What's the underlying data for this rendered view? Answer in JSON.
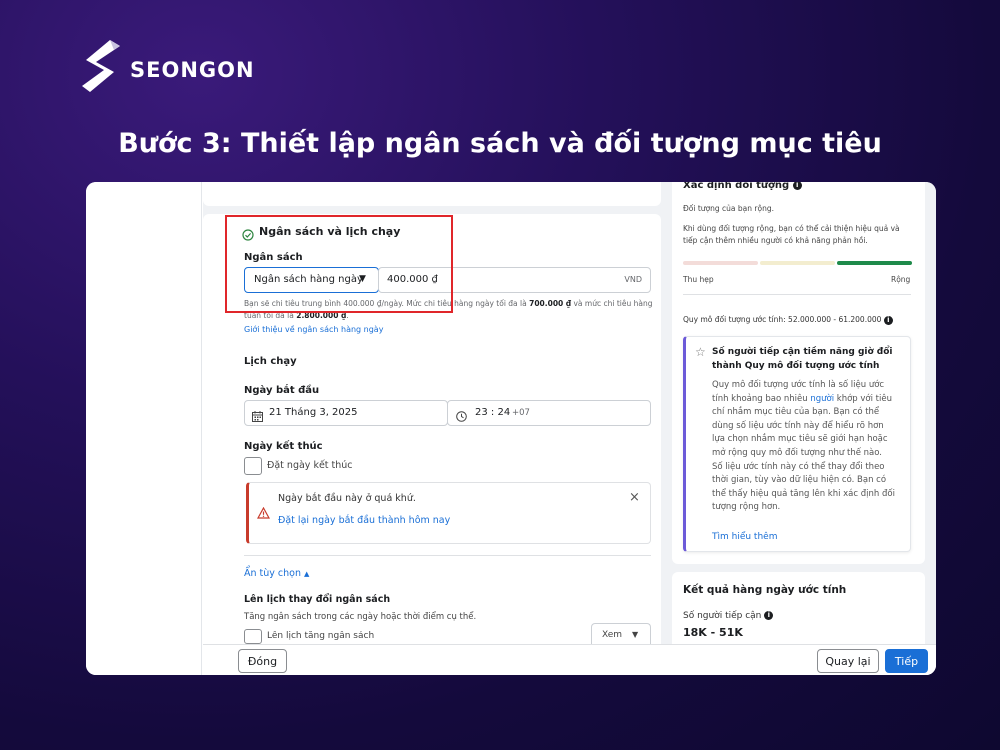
{
  "brand": {
    "name": "SEONGON"
  },
  "headline": "Bước 3: Thiết lập ngân sách và đối tượng mục tiêu",
  "budget_section": {
    "title": "Ngân sách và lịch chạy",
    "budget_label": "Ngân sách",
    "budget_type": "Ngân sách hàng ngày",
    "budget_amount": "400.000 ₫",
    "currency": "VND",
    "note_line1_a": "Bạn sẽ chi tiêu trung bình 400.000 ₫/ngày. Mức chi tiêu hàng ngày tối đa là ",
    "note_line1_b": "700.000 ₫",
    "note_line1_c": " và mức chi tiêu hàng",
    "note_line2_a": "tuần tối đa là ",
    "note_line2_b": "2.800.000 ₫",
    "note_line2_c": ".",
    "intro_link": "Giới thiệu về ngân sách hàng ngày"
  },
  "schedule": {
    "title": "Lịch chạy",
    "start_label": "Ngày bắt đầu",
    "start_date": "21 Tháng 3, 2025",
    "start_time": "23 : 24",
    "timezone": "+07",
    "end_label": "Ngày kết thúc",
    "end_checkbox": "Đặt ngày kết thúc",
    "warning_text": "Ngày bắt đầu này ở quá khứ.",
    "warning_link": "Đặt lại ngày bắt đầu thành hôm nay",
    "toggle_link": "Ẩn tùy chọn",
    "change_title": "Lên lịch thay đổi ngân sách",
    "change_desc": "Tăng ngân sách trong các ngày hoặc thời điểm cụ thể.",
    "change_checkbox": "Lên lịch tăng ngân sách",
    "change_select": "Xem"
  },
  "audience": {
    "title": "Xác định đối tượng",
    "subtitle": "Đối tượng của bạn rộng.",
    "desc_line1": "Khi dùng đối tượng rộng, bạn có thể cải thiện hiệu quả và",
    "desc_line2": "tiếp cận thêm nhiều người có khả năng phản hồi.",
    "narrow": "Thu hẹp",
    "broad": "Rộng",
    "estimate_label": "Quy mô đối tượng ước tính: 52.000.000 - 61.200.000",
    "info_title_1": "Số người tiếp cận tiềm năng giờ đổi",
    "info_title_2": "thành Quy mô đối tượng ước tính",
    "info_body": [
      "Quy mô đối tượng ước tính là số liệu ước",
      "tính khoảng bao nhiêu ",
      "người",
      " khớp với tiêu",
      "chí nhắm mục tiêu của bạn. Bạn có thể",
      "dùng số liệu ước tính này để hiểu rõ hơn",
      "lựa chọn nhắm mục tiêu sẽ giới hạn hoặc",
      "mở rộng quy mô đối tượng như thế nào.",
      "Số liệu ước tính này có thể thay đổi theo",
      "thời gian, tùy vào dữ liệu hiện có. Bạn có",
      "thể thấy hiệu quả tăng lên khi xác định đối",
      "tượng rộng hơn."
    ],
    "learn_more": "Tìm hiểu thêm"
  },
  "results": {
    "title": "Kết quả hàng ngày ước tính",
    "reach_label": "Số người tiếp cận",
    "reach_value": "18K - 51K"
  },
  "footer": {
    "close": "Đóng",
    "back": "Quay lại",
    "next": "Tiếp"
  },
  "colors": {
    "accent": "#1a6fd6",
    "highlight": "#e0262a",
    "warning": "#c83b2b",
    "info": "#6c5ad8",
    "gauge_active": "#1e8a4a"
  }
}
